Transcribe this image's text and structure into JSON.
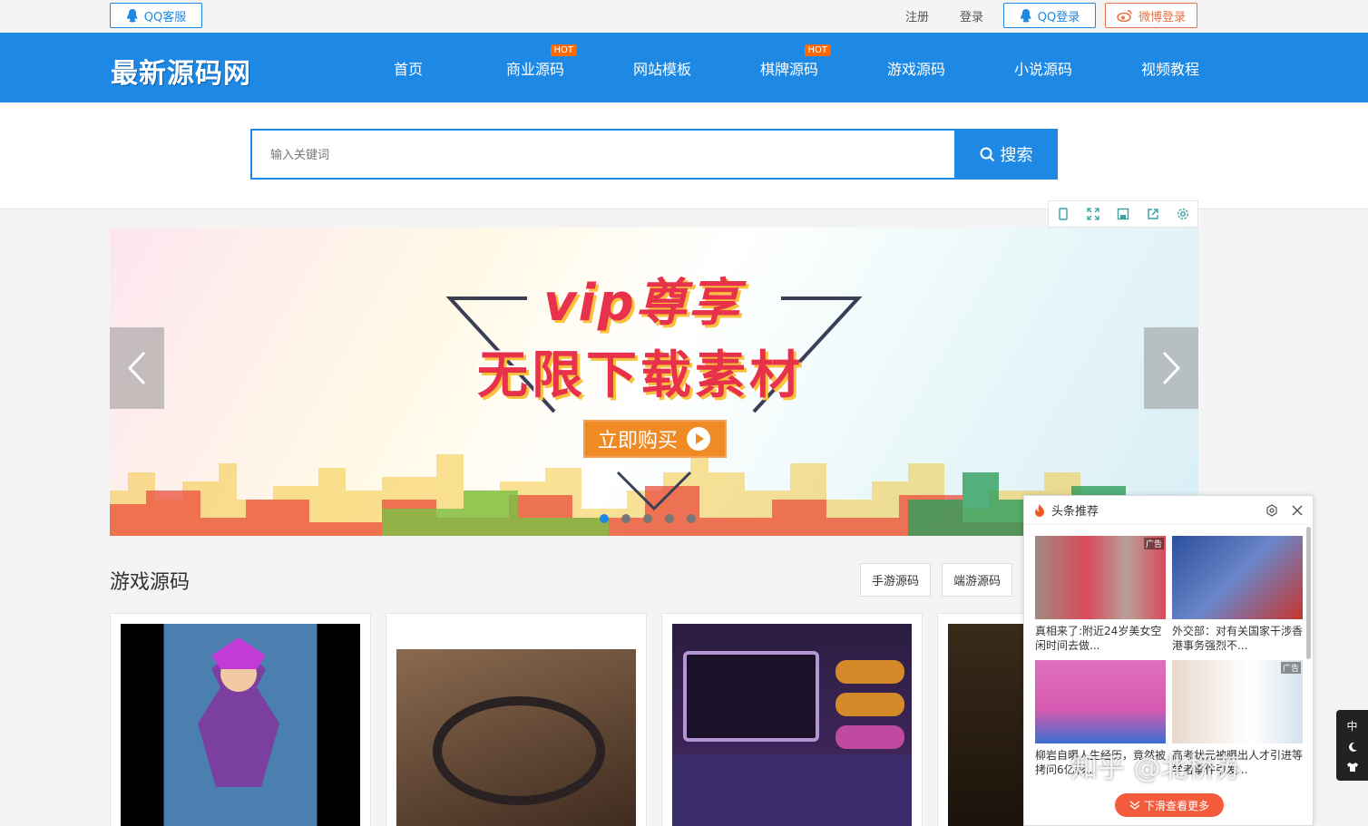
{
  "topbar": {
    "qq_service": "QQ客服",
    "register": "注册",
    "login": "登录",
    "qq_login": "QQ登录",
    "weibo_login": "微博登录"
  },
  "logo": "最新源码网",
  "nav": {
    "items": [
      {
        "label": "首页"
      },
      {
        "label": "商业源码",
        "badge": "HOT"
      },
      {
        "label": "网站模板"
      },
      {
        "label": "棋牌源码",
        "badge": "HOT"
      },
      {
        "label": "游戏源码"
      },
      {
        "label": "小说源码"
      },
      {
        "label": "视频教程"
      }
    ]
  },
  "search": {
    "placeholder": "输入关键词",
    "button": "搜索"
  },
  "banner": {
    "vip": "vip尊享",
    "headline": "无限下载素材",
    "cta": "立即购买"
  },
  "section": {
    "title": "游戏源码",
    "tabs": [
      "手游源码",
      "端游源码"
    ]
  },
  "feed": {
    "title": "头条推荐",
    "ad_label": "广告",
    "items": [
      {
        "text": "真相来了:附近24岁美女空闲时间去做...",
        "ad": true
      },
      {
        "text": "外交部：对有关国家干涉香港事务强烈不...",
        "ad": false
      },
      {
        "text": "柳岩自曝人生经历，竟然被拷问6亿彩...",
        "ad": false
      },
      {
        "text": "高考状元被曝出人才引进等学者事件引发...",
        "ad": true
      }
    ],
    "more": "下滑查看更多"
  },
  "side_widget": {
    "lang": "中"
  },
  "watermark": "知乎 @北桥苏",
  "colors": {
    "primary": "#1e88e5",
    "hot": "#ff6a00",
    "weibo": "#e8744a"
  }
}
